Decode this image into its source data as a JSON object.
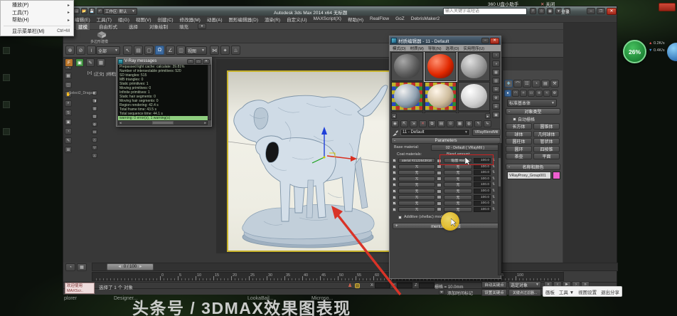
{
  "desktop": {
    "notification": {
      "text": "360 U盘小助手",
      "close_x": "✕",
      "close_label": "关闭"
    },
    "context_menu": {
      "items": [
        {
          "label": "播放(P)",
          "arrow": "▸"
        },
        {
          "label": "工具(T)",
          "arrow": "▸"
        },
        {
          "label": "帮助(H)",
          "arrow": "▸"
        },
        {
          "label": "显示菜单栏(M)",
          "shortcut": "Ctrl+M",
          "separator_before": true
        }
      ]
    },
    "badge": {
      "percent": "26%",
      "up_speed": "0.2K/s",
      "down_speed": "0.4K/s"
    },
    "taskbar": [
      "plorer",
      "Designer...",
      "LookaBail...",
      "Microso..."
    ],
    "watermark": "头条号 / 3DMAX效果图表现",
    "share_toolbar": [
      "画板",
      "工具 ▼",
      "视图设置",
      "退出分享"
    ]
  },
  "titlebar": {
    "workspace": "工作区: 默认",
    "title": "Autodesk 3ds Max 2014 x64  无标题",
    "search_placeholder": "输入关键字或短语",
    "signin": "登录"
  },
  "menubar": {
    "items": [
      "编辑(E)",
      "工具(T)",
      "组(G)",
      "视图(V)",
      "创建(C)",
      "修改器(M)",
      "动画(A)",
      "图形编辑器(D)",
      "渲染(R)",
      "自定义(U)",
      "MAXScript(X)",
      "帮助(H)",
      "RealFlow",
      "GoZ",
      "DebrisMaker2"
    ]
  },
  "ribbon": {
    "tabs": [
      "建模",
      "自由形式",
      "选择",
      "对象绘制",
      "填充"
    ],
    "panel_label": "多边形建模"
  },
  "toolbar": {
    "filter_value": "全部",
    "coord_value": "视图",
    "left_icons": [
      "select-and-link",
      "unlink-selection",
      "bind-to-space-warp"
    ],
    "mid_icons": [
      "select-object",
      "select-by-name",
      "rectangular-region",
      "snaps-toggle",
      "angle-snap",
      "window-crossing"
    ],
    "right_icons": [
      "mirror",
      "align",
      "render-production"
    ],
    "active_icon": "snaps-toggle"
  },
  "left_viewport": {
    "labels": [
      "[+]",
      "[正交]",
      "[线框]"
    ],
    "floater_label": "Select2_Draga"
  },
  "vray_messages": {
    "title": "V-Ray messages",
    "lines": [
      "Prepassed light cache: calculate: 39.81%",
      "Number of intersectable primitives: 520",
      "SD triangles: 515",
      "MB triangles: 0",
      "Static primitives: 1",
      "Moving primitives: 0",
      "Infinite primitives: 1",
      "Static hair segments: 0",
      "Moving hair segments: 0",
      "Region rendering: 42.4 s",
      "Total frame time: 43.5 s",
      "Total sequence time: 44.1 s"
    ],
    "warning_line": "warning: 0 error(s), 1 warning(s)"
  },
  "material_editor": {
    "title": "材质编辑器 - 11 - Default",
    "menus": [
      "模式(D)",
      "材质(M)",
      "导航(N)",
      "选项(O)",
      "实用程序(U)"
    ],
    "sample_slots": [
      {
        "bg": "#4a4a4a",
        "sphere": [
          "#a8a8a8",
          "#5c5c5c",
          "#303030"
        ]
      },
      {
        "bg": "#4a4a4a",
        "sphere": [
          "#ff9070",
          "#e02800",
          "#6a0800"
        ]
      },
      {
        "bg": "#4a4a4a",
        "sphere": [
          "#e0e0e0",
          "#9a9a9a",
          "#585858"
        ]
      },
      {
        "bg": "checker",
        "sphere": [
          "#f0f0f0",
          "#8fa0b0",
          "#2a3440"
        ]
      },
      {
        "bg": "checker",
        "sphere": [
          "#fff6ea",
          "#cdbb9b",
          "#6d6352"
        ]
      },
      {
        "bg": "#4a4a4a",
        "sphere": [
          "#ffffff",
          "#cfcfcf",
          "#8f8f8f"
        ]
      },
      {
        "bg": "#4a4a4a",
        "sphere": [
          "#ffffff",
          "#cccccc",
          "#909090"
        ]
      },
      {
        "bg": "#4a4a4a",
        "sphere": [
          "#ffffff",
          "#cccccc",
          "#909090"
        ]
      },
      {
        "bg": "#4a4a4a",
        "sphere": [
          "#ffffff",
          "#cccccc",
          "#909090"
        ]
      }
    ],
    "checker_colors": [
      "#c03028",
      "#2c9030",
      "#2848c0",
      "#c0b428"
    ],
    "toolbar_icons": [
      "get-material",
      "put-material",
      "assign-to-selection",
      "reset-map",
      "make-unique",
      "put-to-library",
      "material-id",
      "show-map-in-viewport",
      "show-end-result",
      "go-to-parent",
      "go-forward-sibling"
    ],
    "side_icons": [
      "sample-type",
      "backlight",
      "background",
      "sample-tiling",
      "video-color-check",
      "options",
      "select-by-material",
      "material-map-navigator"
    ],
    "name_value": "11 - Default",
    "type_button": "VRayBlendMtl",
    "rollout_parameters": "Parameters",
    "base_label": "Base material:",
    "base_value": "02 - Default ( VRayMtl )",
    "coat_label": "Coat materials:",
    "blend_label": "Blend amount:",
    "coat_rows": [
      {
        "mat": "aterial #2122643918",
        "blend": "贴图 #94",
        "amount": "100.0"
      },
      {
        "mat": "无",
        "blend": "无",
        "amount": "100.0"
      },
      {
        "mat": "无",
        "blend": "无",
        "amount": "100.0"
      },
      {
        "mat": "无",
        "blend": "无",
        "amount": "100.0"
      },
      {
        "mat": "无",
        "blend": "无",
        "amount": "100.0"
      },
      {
        "mat": "无",
        "blend": "无",
        "amount": "100.0"
      },
      {
        "mat": "无",
        "blend": "无",
        "amount": "100.0"
      },
      {
        "mat": "无",
        "blend": "无",
        "amount": "100.0"
      },
      {
        "mat": "无",
        "blend": "无",
        "amount": "100.0"
      }
    ],
    "additive_label": "Additive (shellac) mode",
    "bottom_rollout": "mental ray 连接",
    "highlight_color": "#cc2222"
  },
  "command_panel": {
    "tabs": [
      "create",
      "modify",
      "hierarchy",
      "motion",
      "display",
      "utilities"
    ],
    "sub_icons": [
      "geometry",
      "shapes",
      "lights",
      "cameras",
      "helpers",
      "space-warps",
      "systems"
    ],
    "category_value": "标准基本体",
    "rollout_object_type": "对象类型",
    "autogrid_label": "自动栅格",
    "buttons": [
      "长方体",
      "圆锥体",
      "球体",
      "几何球体",
      "圆柱体",
      "管状体",
      "圆环",
      "四棱锥",
      "茶壶",
      "平面"
    ],
    "rollout_name_color": "名称和颜色",
    "object_name": "VRayProxy_Group001",
    "object_color": "#ee5fd0"
  },
  "timeline": {
    "slider_value": "0 / 100",
    "tick_min": 0,
    "tick_max": 100,
    "tick_step": 5
  },
  "statusbar": {
    "welcome_line1": "欢迎使用",
    "welcome_line2": "MAXScr..",
    "selected_text": "选择了 1 个 对象",
    "x_label": "X:",
    "y_label": "Y:",
    "z_label": "Z:",
    "grid_text": "栅格 = 10.0mm",
    "add_time_tag": "添加时间标记",
    "auto_key": "自动关键点",
    "selected_mode": "选定对象",
    "set_key": "设置关键点",
    "key_filters": "关键点过滤器...",
    "playback_icons": [
      "go-to-start",
      "previous-frame",
      "play",
      "next-frame",
      "go-to-end"
    ]
  },
  "colors": {
    "accent_red": "#d93327",
    "active_border": "#c6b22c",
    "snap_active": "#3d6a9e"
  }
}
